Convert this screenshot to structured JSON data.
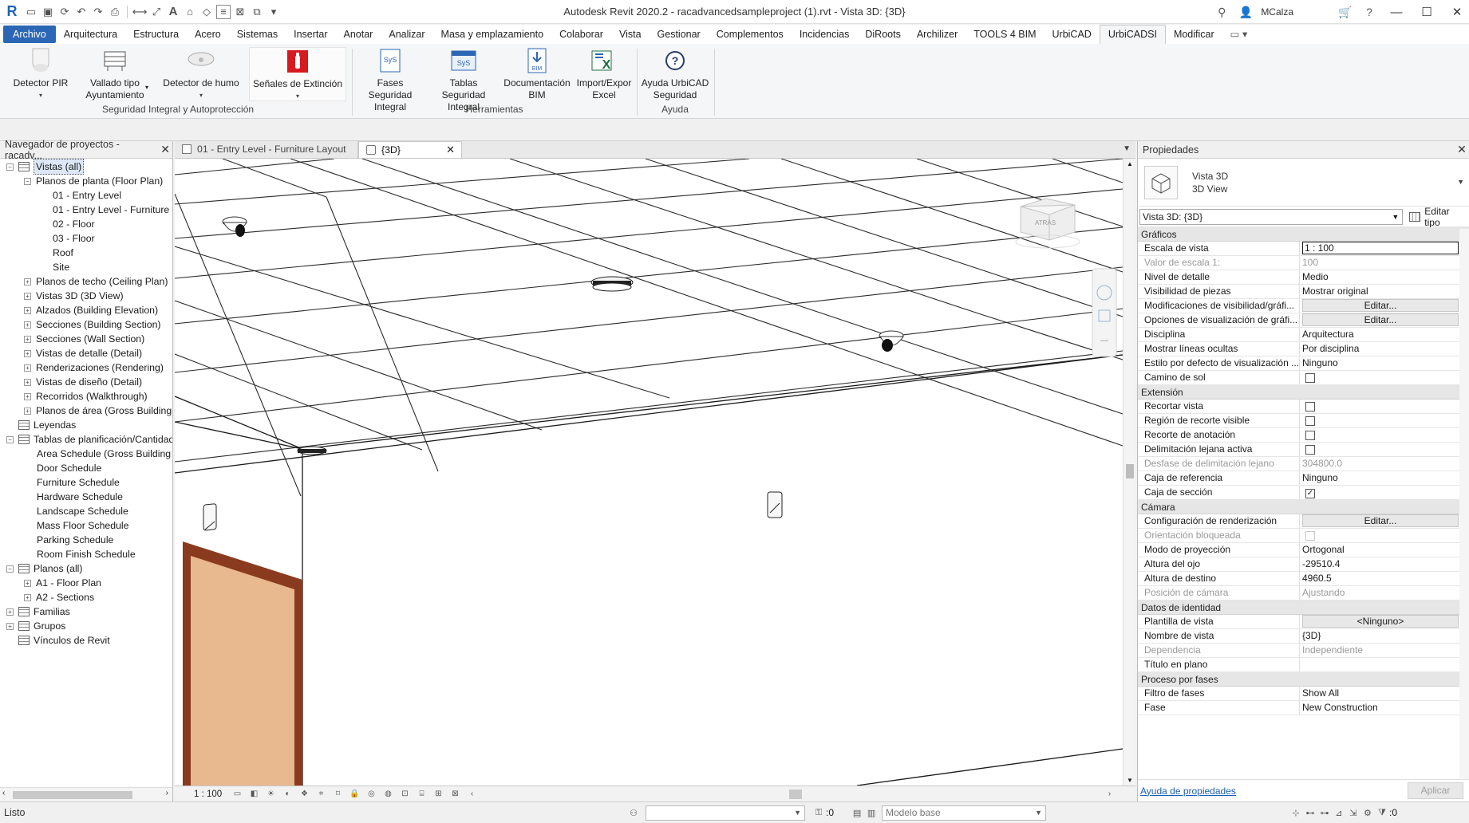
{
  "app": {
    "logo": "R",
    "title": "Autodesk Revit 2020.2 - racadvancedsampleproject (1).rvt - Vista 3D: {3D}",
    "user": "MCalza"
  },
  "quick_access_icons": [
    "open-icon",
    "save-icon",
    "sync-icon",
    "undo-icon",
    "redo-icon",
    "print-icon",
    "measure-icon",
    "dimension-icon",
    "text-icon",
    "3d-view-icon",
    "section-icon",
    "thin-lines-icon",
    "close-windows-icon",
    "switch-windows-icon",
    "customize-icon"
  ],
  "ribbon_tabs": [
    "Archivo",
    "Arquitectura",
    "Estructura",
    "Acero",
    "Sistemas",
    "Insertar",
    "Anotar",
    "Analizar",
    "Masa y emplazamiento",
    "Colaborar",
    "Vista",
    "Gestionar",
    "Complementos",
    "Incidencias",
    "DiRoots",
    "Archilizer",
    "TOOLS 4 BIM",
    "UrbiCAD",
    "UrbiCADSI",
    "Modificar"
  ],
  "ribbon": {
    "buttons": [
      {
        "label": "Detector PIR",
        "label2": "",
        "icon": "pir-sensor-icon"
      },
      {
        "label": "Vallado tipo",
        "label2": "Ayuntamiento",
        "icon": "fence-icon"
      },
      {
        "label": "Detector de humo",
        "label2": "",
        "icon": "smoke-detector-icon"
      },
      {
        "label": "Señales de Extinción",
        "label2": "",
        "icon": "extinguisher-sign-icon"
      },
      {
        "label": "Fases Seguridad",
        "label2": "Integral",
        "icon": "sys-phases-icon"
      },
      {
        "label": "Tablas Seguridad",
        "label2": "Integral",
        "icon": "sys-tables-icon"
      },
      {
        "label": "Documentación",
        "label2": "BIM",
        "icon": "bim-document-icon"
      },
      {
        "label": "Import/Expor",
        "label2": "Excel",
        "icon": "excel-icon"
      },
      {
        "label": "Ayuda UrbiCAD",
        "label2": "Seguridad",
        "icon": "help-icon"
      }
    ],
    "groups": [
      "Seguridad Integral y Autoprotección",
      "Herramientas",
      "Ayuda"
    ]
  },
  "browser": {
    "title": "Navegador de proyectos - racadv...",
    "nodes": [
      {
        "label": "Vistas (all)",
        "expand": "−",
        "icon": true
      },
      {
        "label": "Planos de planta (Floor Plan)",
        "expand": "−",
        "icon": false
      },
      {
        "label": "01 - Entry Level",
        "expand": "",
        "icon": false
      },
      {
        "label": "01 - Entry Level - Furniture",
        "expand": "",
        "icon": false
      },
      {
        "label": "02 - Floor",
        "expand": "",
        "icon": false
      },
      {
        "label": "03 - Floor",
        "expand": "",
        "icon": false
      },
      {
        "label": "Roof",
        "expand": "",
        "icon": false
      },
      {
        "label": "Site",
        "expand": "",
        "icon": false
      },
      {
        "label": "Planos de techo (Ceiling Plan)",
        "expand": "+",
        "icon": false
      },
      {
        "label": "Vistas 3D (3D View)",
        "expand": "+",
        "icon": false
      },
      {
        "label": "Alzados (Building Elevation)",
        "expand": "+",
        "icon": false
      },
      {
        "label": "Secciones (Building Section)",
        "expand": "+",
        "icon": false
      },
      {
        "label": "Secciones (Wall Section)",
        "expand": "+",
        "icon": false
      },
      {
        "label": "Vistas de detalle (Detail)",
        "expand": "+",
        "icon": false
      },
      {
        "label": "Renderizaciones (Rendering)",
        "expand": "+",
        "icon": false
      },
      {
        "label": "Vistas de diseño (Detail)",
        "expand": "+",
        "icon": false
      },
      {
        "label": "Recorridos (Walkthrough)",
        "expand": "+",
        "icon": false
      },
      {
        "label": "Planos de área (Gross Building",
        "expand": "+",
        "icon": false
      },
      {
        "label": "Leyendas",
        "expand": "",
        "icon": true
      },
      {
        "label": "Tablas de planificación/Cantidad",
        "expand": "−",
        "icon": true
      },
      {
        "label": "Area Schedule (Gross Building",
        "expand": "",
        "icon": false
      },
      {
        "label": "Door Schedule",
        "expand": "",
        "icon": false
      },
      {
        "label": "Furniture Schedule",
        "expand": "",
        "icon": false
      },
      {
        "label": "Hardware Schedule",
        "expand": "",
        "icon": false
      },
      {
        "label": "Landscape Schedule",
        "expand": "",
        "icon": false
      },
      {
        "label": "Mass Floor Schedule",
        "expand": "",
        "icon": false
      },
      {
        "label": "Parking Schedule",
        "expand": "",
        "icon": false
      },
      {
        "label": "Room Finish Schedule",
        "expand": "",
        "icon": false
      },
      {
        "label": "Planos (all)",
        "expand": "−",
        "icon": true
      },
      {
        "label": "A1 - Floor Plan",
        "expand": "+",
        "icon": false
      },
      {
        "label": "A2 - Sections",
        "expand": "+",
        "icon": false
      },
      {
        "label": "Familias",
        "expand": "+",
        "icon": true
      },
      {
        "label": "Grupos",
        "expand": "+",
        "icon": true
      },
      {
        "label": "Vínculos de Revit",
        "expand": "",
        "icon": true
      }
    ]
  },
  "view_tabs": [
    "01 - Entry Level - Furniture Layout",
    "{3D}"
  ],
  "view_bar": {
    "scale": "1 : 100"
  },
  "viewcube": {
    "face_label": "ATRÁS"
  },
  "properties": {
    "title": "Propiedades",
    "type_name": "Vista 3D",
    "type_sub": "3D View",
    "instance_selector": "Vista 3D: {3D}",
    "edit_type": "Editar tipo",
    "sections": [
      {
        "name": "Gráficos",
        "rows": [
          {
            "name": "Escala de vista",
            "value": "1 : 100",
            "kind": "input"
          },
          {
            "name": "Valor de escala    1:",
            "value": "100",
            "kind": "dim"
          },
          {
            "name": "Nivel de detalle",
            "value": "Medio",
            "kind": "text"
          },
          {
            "name": "Visibilidad de piezas",
            "value": "Mostrar original",
            "kind": "text"
          },
          {
            "name": "Modificaciones de visibilidad/gráfi...",
            "value": "Editar...",
            "kind": "button"
          },
          {
            "name": "Opciones de visualización de gráfi...",
            "value": "Editar...",
            "kind": "button"
          },
          {
            "name": "Disciplina",
            "value": "Arquitectura",
            "kind": "text"
          },
          {
            "name": "Mostrar líneas ocultas",
            "value": "Por disciplina",
            "kind": "text"
          },
          {
            "name": "Estilo por defecto de visualización ...",
            "value": "Ninguno",
            "kind": "text"
          },
          {
            "name": "Camino de sol",
            "value": "",
            "kind": "check",
            "checked": false
          }
        ]
      },
      {
        "name": "Extensión",
        "rows": [
          {
            "name": "Recortar vista",
            "value": "",
            "kind": "check",
            "checked": false
          },
          {
            "name": "Región de recorte visible",
            "value": "",
            "kind": "check",
            "checked": false
          },
          {
            "name": "Recorte de anotación",
            "value": "",
            "kind": "check",
            "checked": false
          },
          {
            "name": "Delimitación lejana activa",
            "value": "",
            "kind": "check",
            "checked": false
          },
          {
            "name": "Desfase de delimitación lejano",
            "value": "304800.0",
            "kind": "dim"
          },
          {
            "name": "Caja de referencia",
            "value": "Ninguno",
            "kind": "text"
          },
          {
            "name": "Caja de sección",
            "value": "",
            "kind": "check",
            "checked": true
          }
        ]
      },
      {
        "name": "Cámara",
        "rows": [
          {
            "name": "Configuración de renderización",
            "value": "Editar...",
            "kind": "button"
          },
          {
            "name": "Orientación bloqueada",
            "value": "",
            "kind": "checkdim",
            "checked": false
          },
          {
            "name": "Modo de proyección",
            "value": "Ortogonal",
            "kind": "text"
          },
          {
            "name": "Altura del ojo",
            "value": "-29510.4",
            "kind": "text"
          },
          {
            "name": "Altura de destino",
            "value": "4960.5",
            "kind": "text"
          },
          {
            "name": "Posición de cámara",
            "value": "Ajustando",
            "kind": "dim"
          }
        ]
      },
      {
        "name": "Datos de identidad",
        "rows": [
          {
            "name": "Plantilla de vista",
            "value": "<Ninguno>",
            "kind": "button"
          },
          {
            "name": "Nombre de vista",
            "value": "{3D}",
            "kind": "text"
          },
          {
            "name": "Dependencia",
            "value": "Independiente",
            "kind": "dim"
          },
          {
            "name": "Título en plano",
            "value": "",
            "kind": "text"
          }
        ]
      },
      {
        "name": "Proceso por fases",
        "rows": [
          {
            "name": "Filtro de fases",
            "value": "Show All",
            "kind": "text"
          },
          {
            "name": "Fase",
            "value": "New Construction",
            "kind": "text"
          }
        ]
      }
    ],
    "help_link": "Ayuda de propiedades",
    "apply": "Aplicar"
  },
  "status": {
    "text": "Listo",
    "worksets_count": ":0",
    "design_option": "Modelo base",
    "filter_count": ":0"
  },
  "colors": {
    "accent": "#2b67b4",
    "door_frame": "#8a3a1e",
    "door_panel": "#e8b88e"
  }
}
